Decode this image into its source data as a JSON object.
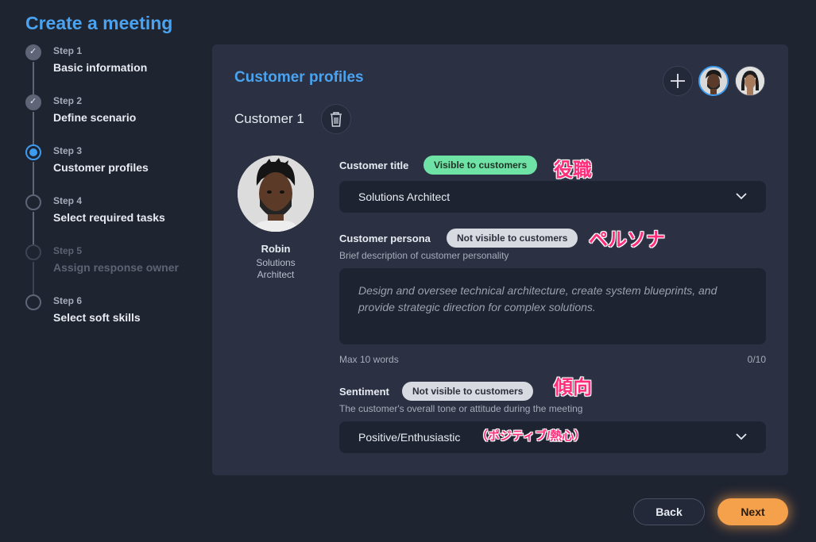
{
  "page": {
    "title": "Create a meeting"
  },
  "steps": [
    {
      "label": "Step 1",
      "name": "Basic information",
      "state": "done"
    },
    {
      "label": "Step 2",
      "name": "Define scenario",
      "state": "done"
    },
    {
      "label": "Step 3",
      "name": "Customer profiles",
      "state": "active"
    },
    {
      "label": "Step 4",
      "name": "Select required tasks",
      "state": "pending"
    },
    {
      "label": "Step 5",
      "name": "Assign response owner",
      "state": "disabled"
    },
    {
      "label": "Step 6",
      "name": "Select soft skills",
      "state": "pending"
    }
  ],
  "card": {
    "title": "Customer profiles",
    "customer_heading": "Customer 1",
    "add_icon": "plus-icon",
    "trash_icon": "trash-icon"
  },
  "profile": {
    "name": "Robin",
    "role_line1": "Solutions",
    "role_line2": "Architect"
  },
  "fields": {
    "title": {
      "label": "Customer title",
      "badge": "Visible to customers",
      "value": "Solutions Architect",
      "annotation": "役職"
    },
    "persona": {
      "label": "Customer persona",
      "badge": "Not visible to customers",
      "desc": "Brief description of customer personality",
      "placeholder": "Design and oversee technical architecture, create system blueprints, and provide strategic direction for complex solutions.",
      "limit": "Max 10 words",
      "count": "0/10",
      "annotation": "ペルソナ"
    },
    "sentiment": {
      "label": "Sentiment",
      "badge": "Not visible to customers",
      "desc": "The customer's overall tone or attitude during the meeting",
      "value": "Positive/Enthusiastic",
      "annotation": "傾向",
      "value_annotation": "（ポジティブ/熱心）"
    }
  },
  "footer": {
    "back_label": "Back",
    "next_label": "Next"
  },
  "colors": {
    "accent": "#4aa3f0",
    "visible_badge": "#6fe3a6",
    "hidden_badge": "#d7dae1",
    "next_button": "#f5a04a",
    "annotation": "#ff2d7a"
  }
}
